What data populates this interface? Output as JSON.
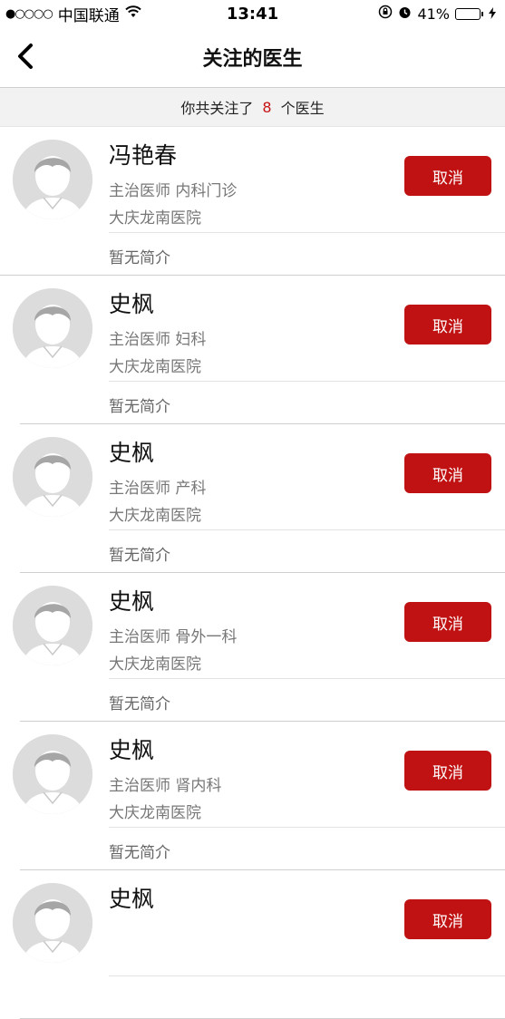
{
  "status_bar": {
    "signal": "●○○○○",
    "carrier": "中国联通",
    "time": "13:41",
    "battery_percent": "41%",
    "battery_level": 0.41
  },
  "nav": {
    "title": "关注的医生"
  },
  "summary": {
    "prefix": "你共关注了",
    "count": "8",
    "suffix": "个医生"
  },
  "colors": {
    "accent": "#c01212",
    "count_red": "#c81414",
    "battery_green": "#3ccf3c"
  },
  "doctors": [
    {
      "name": "冯艳春",
      "title_dept": "主治医师  内科门诊",
      "hospital": "大庆龙南医院",
      "intro": "暂无简介",
      "button": "取消"
    },
    {
      "name": "史枫",
      "title_dept": "主治医师  妇科",
      "hospital": "大庆龙南医院",
      "intro": "暂无简介",
      "button": "取消"
    },
    {
      "name": "史枫",
      "title_dept": "主治医师  产科",
      "hospital": "大庆龙南医院",
      "intro": "暂无简介",
      "button": "取消"
    },
    {
      "name": "史枫",
      "title_dept": "主治医师  骨外一科",
      "hospital": "大庆龙南医院",
      "intro": "暂无简介",
      "button": "取消"
    },
    {
      "name": "史枫",
      "title_dept": "主治医师  肾内科",
      "hospital": "大庆龙南医院",
      "intro": "暂无简介",
      "button": "取消"
    },
    {
      "name": "史枫",
      "title_dept": "",
      "hospital": "",
      "intro": "",
      "button": "取消"
    }
  ]
}
